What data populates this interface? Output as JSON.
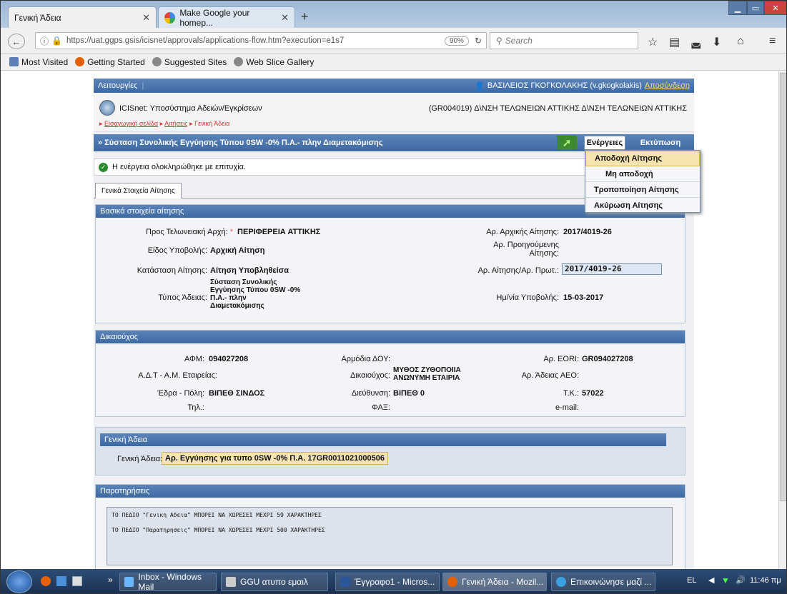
{
  "browser": {
    "tabs": [
      {
        "label": "Γενική Άδεια"
      },
      {
        "label": "Make Google your homep..."
      }
    ],
    "url": "https://uat.ggps.gsis/icisnet/approvals/applications-flow.htm?execution=e1s7",
    "zoom": "90%",
    "search_placeholder": "Search",
    "bookmarks": [
      "Most Visited",
      "Getting Started",
      "Suggested Sites",
      "Web Slice Gallery"
    ]
  },
  "app": {
    "menu_label": "Λειτουργίες",
    "user": "ΒΑΣΙΛΕΙΟΣ ΓΚΟΓΚΟΛΑΚΗΣ (v.gkogkolakis)",
    "logout": "Αποσύνδεση",
    "system_title": "ICISnet: Υποσύστημα Αδειών/Εγκρίσεων",
    "office": "(GR004019) Δ\\ΝΣΗ ΤΕΛΩΝΕΙΩΝ ΑΤΤΙΚΗΣ Δ\\ΝΣΗ ΤΕΛΩΝΕΙΩΝ ΑΤΤΙΚΗΣ",
    "breadcrumb": [
      "Εισαγωγική σελίδα",
      "Αιτήσεις",
      "Γενική Άδεια"
    ],
    "page_title": "» Σύσταση Συνολικής Εγγύησης Τύπου 0SW -0% Π.Α.- πλην Διαμετακόμισης",
    "actions_label": "Ενέργειες",
    "print_label": "Εκτύπωση",
    "success_msg": "Η ενέργεια ολοκληρώθηκε με επιτυχία.",
    "tab_general": "Γενικά Στοιχεία Αίτησης",
    "actions_menu": [
      "Αποδοχή Αίτησης",
      "Μη αποδοχή",
      "Τροποποίηση Αίτησης",
      "Ακύρωση Αίτησης"
    ]
  },
  "basic": {
    "header": "Βασικά στοιχεία αίτησης",
    "customs_label": "Προς Τελωνειακή Αρχή:",
    "customs_val": "ΠΕΡΙΦΕΡΕΙΑ ΑΤΤΙΚΗΣ",
    "subtype_label": "Είδος Υποβολής:",
    "subtype_val": "Αρχική Αίτηση",
    "status_label": "Κατάσταση Αίτησης:",
    "status_val": "Αίτηση Υποβληθείσα",
    "type_label": "Τύπος Άδειας:",
    "type_val": [
      "Σύσταση Συνολικής",
      "Εγγύησης Τύπου 0SW -0%",
      "Π.Α.- πλην",
      "Διαμετακόμισης"
    ],
    "initial_label": "Αρ. Αρχικής Αίτησης:",
    "initial_val": "2017/4019-26",
    "prev_label": [
      "Αρ. Προηγούμενης",
      "Αίτησης:"
    ],
    "num_label": "Αρ. Αίτησης/Αρ. Πρωτ.:",
    "num_val": "2017/4019-26",
    "date_label": "Ημ/νία Υποβολής:",
    "date_val": "15-03-2017"
  },
  "holder": {
    "header": "Δικαιούχος",
    "afm_label": "ΑΦΜ:",
    "afm_val": "094027208",
    "doy_label": "Αρμόδια ΔΟΥ:",
    "eori_label": "Αρ. EORI:",
    "eori_val": "GR094027208",
    "adt_label": "Α.Δ.Τ - Α.Μ. Εταιρείας:",
    "holder_label": "Δικαιούχος:",
    "holder_val": [
      "ΜΥΘΟΣ ΖΥΘΟΠΟΙΙΑ",
      "ΑΝΩΝΥΜΗ ΕΤΑΙΡΙΑ"
    ],
    "aeo_label": "Αρ. Άδειας ΑΕΟ:",
    "city_label": "Έδρα - Πόλη:",
    "city_val": "ΒΙΠΕΘ ΣΙΝΔΟΣ",
    "addr_label": "Διεύθυνση:",
    "addr_val": "ΒΙΠΕΘ 0",
    "tk_label": "Τ.Κ.:",
    "tk_val": "57022",
    "tel_label": "Τηλ.:",
    "fax_label": "ΦΑΞ:",
    "email_label": "e-mail:"
  },
  "license": {
    "header": "Γενική Άδεια",
    "label": "Γενική Άδεια:",
    "val": "Αρ. Εγγύησης για τυπο 0SW -0% Π.Α. 17GR0011021000506"
  },
  "remarks": {
    "header": "Παρατηρήσεις",
    "lines": [
      "ΤΟ ΠΕΔΙΟ \"Γενικη Αδεια\" ΜΠΟΡΕΙ ΝΑ ΧΩΡΕΣΕΙ ΜΕΧΡΙ 59 ΧΑΡΑΚΤΗΡΕΣ",
      "ΤΟ ΠΕΔΙΟ \"Παρατηρησεις\"  ΜΠΟΡΕΙ ΝΑ ΧΩΡΕΣΕΙ ΜΕΧΡΙ 500 ΧΑΡΑΚΤΗΡΕΣ"
    ]
  },
  "taskbar": {
    "items": [
      "Inbox - Windows Mail",
      "GGU ατυπο εμαιλ",
      "Έγγραφο1 - Micros...",
      "Γενική Άδεια - Mozil...",
      "Επικοινώνησε μαζί ..."
    ],
    "lang": "EL",
    "clock": "11:46 πμ"
  }
}
